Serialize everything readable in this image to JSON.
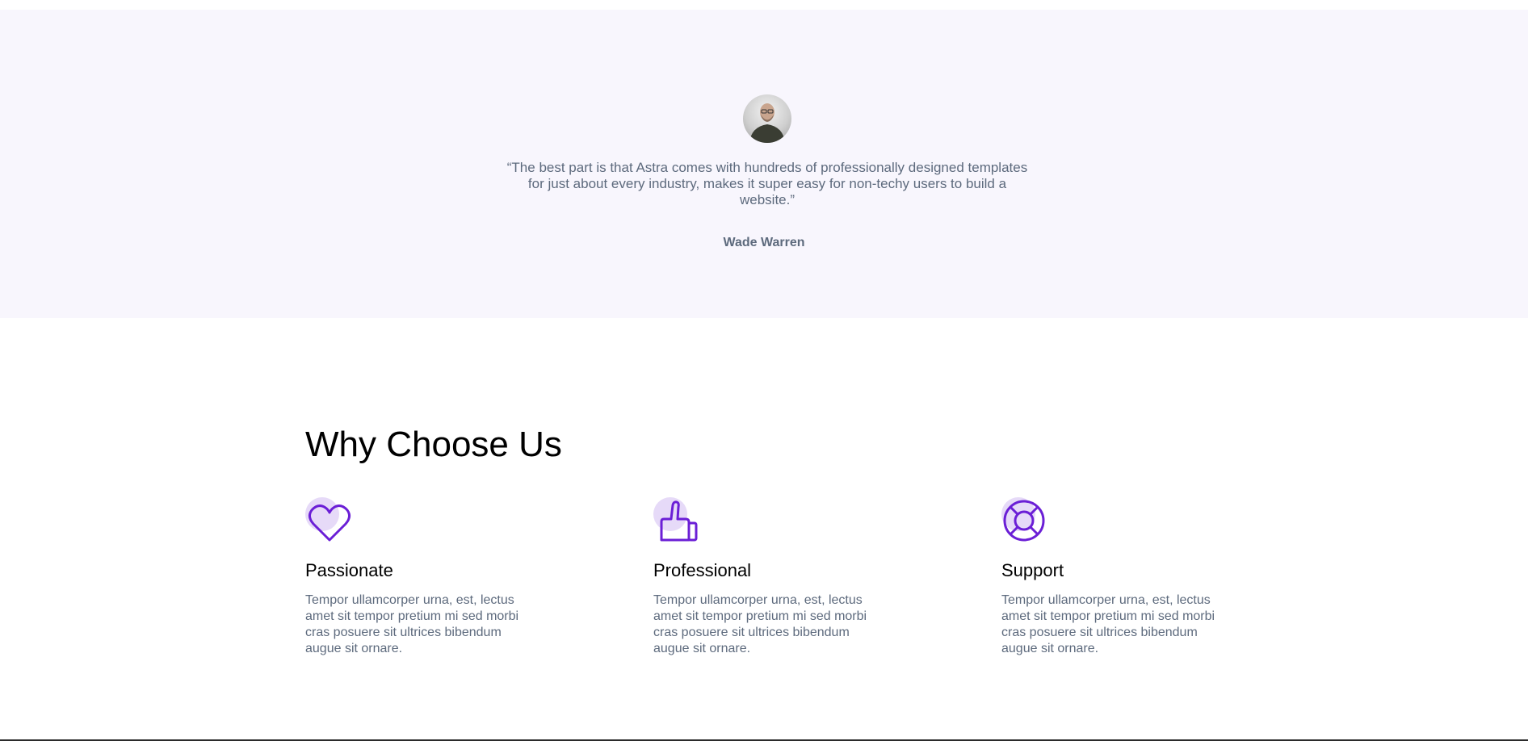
{
  "testimonial": {
    "avatar_icon": "person-photo",
    "quote": "“The best part is that Astra comes with hundreds of professionally designed templates for just about every industry, makes it super easy for non-techy users to build a website.”",
    "author": "Wade Warren"
  },
  "why": {
    "title": "Why Choose Us",
    "features": [
      {
        "icon": "heart-icon",
        "title": "Passionate",
        "description": "Tempor ullamcorper urna, est, lectus amet sit tempor pretium mi sed morbi cras posuere sit ultrices bibendum augue sit ornare."
      },
      {
        "icon": "thumbs-up-icon",
        "title": "Professional",
        "description": "Tempor ullamcorper urna, est, lectus amet sit tempor pretium mi sed morbi cras posuere sit ultrices bibendum augue sit ornare."
      },
      {
        "icon": "lifebuoy-icon",
        "title": "Support",
        "description": "Tempor ullamcorper urna, est, lectus amet sit tempor pretium mi sed morbi cras posuere sit ultrices bibendum augue sit ornare."
      }
    ]
  },
  "colors": {
    "testimonial_bg": "#f8f6fd",
    "icon_accent": "#6b1fd6",
    "icon_blob": "#e6daf8",
    "body_text": "#5d6a7d"
  }
}
